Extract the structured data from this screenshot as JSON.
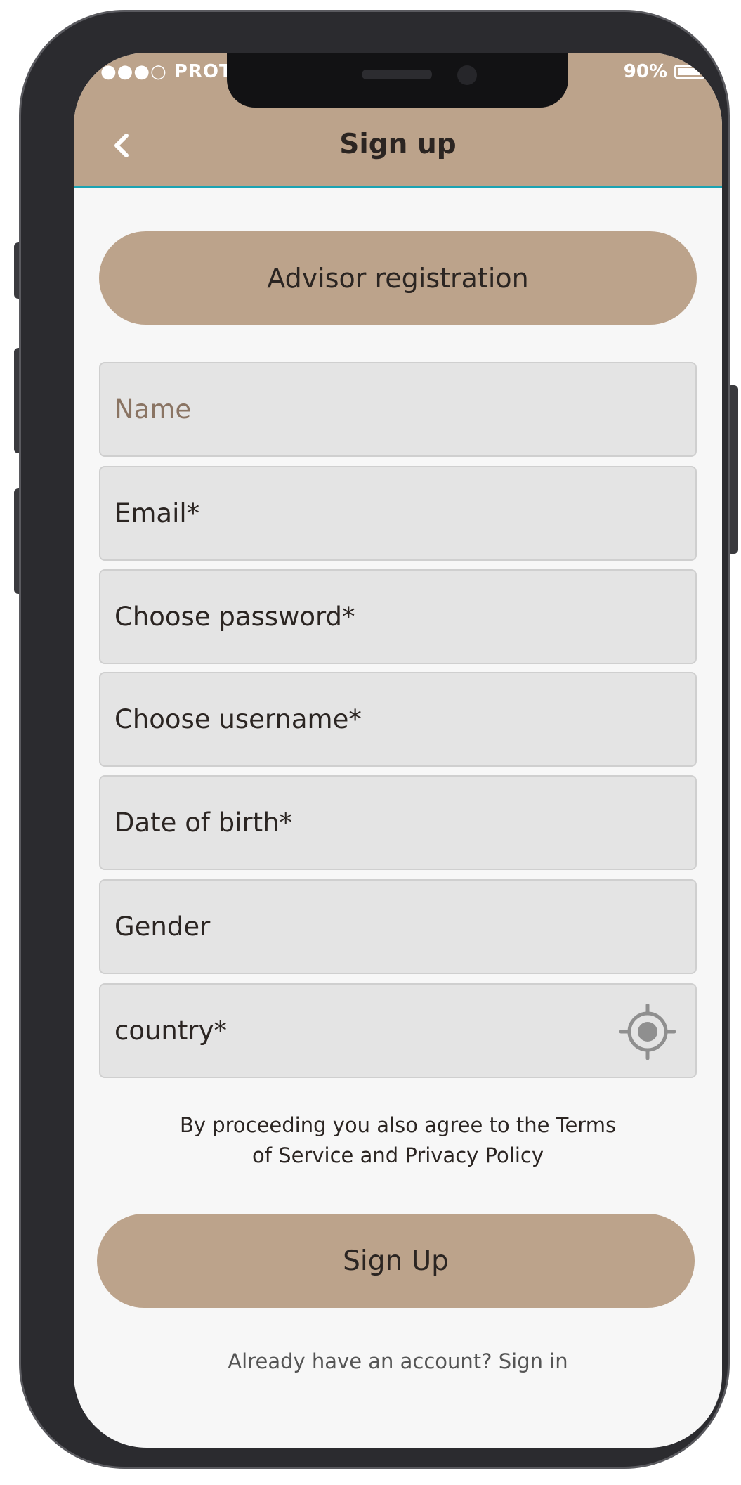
{
  "status_bar": {
    "carrier": "●●●○ PROTO",
    "battery": "90%"
  },
  "header": {
    "title": "Sign up",
    "back_icon": "chevron-left-icon"
  },
  "advisor_button": "Advisor registration",
  "form": {
    "name_placeholder": "Name",
    "email_placeholder": "Email*",
    "password_placeholder": "Choose password*",
    "username_placeholder": "Choose username*",
    "dob_placeholder": "Date of birth*",
    "gender_placeholder": "Gender",
    "country_placeholder": "country*",
    "country_icon": "location-target-icon"
  },
  "terms": {
    "line1": "By proceeding you also agree to the Terms",
    "line2": "of Service and Privacy Policy"
  },
  "signup_button": "Sign Up",
  "signin_link": "Already have an account? Sign in",
  "colors": {
    "accent": "#bca38b",
    "divider": "#1aa3b3",
    "field_bg": "#e4e4e4",
    "screen_bg": "#f7f7f7"
  }
}
